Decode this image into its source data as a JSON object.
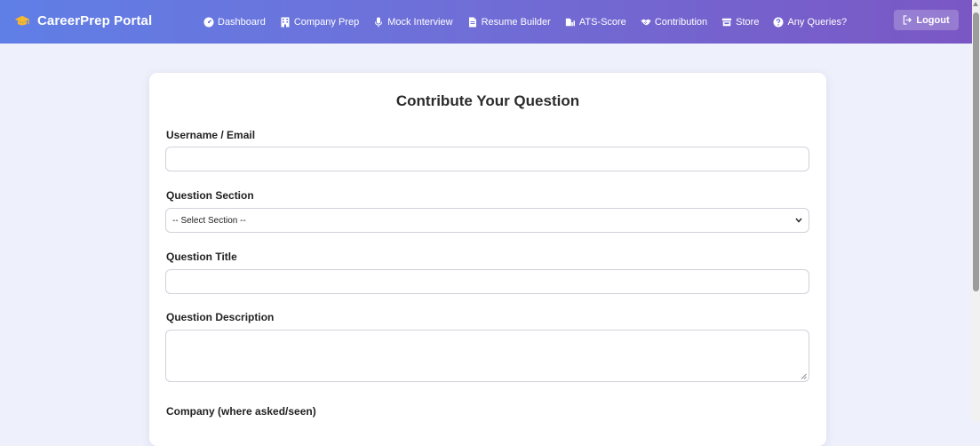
{
  "brand": {
    "title": "CareerPrep Portal",
    "icon": "graduation-cap-icon"
  },
  "nav": {
    "items": [
      {
        "label": "Dashboard",
        "icon": "dashboard-icon"
      },
      {
        "label": "Company Prep",
        "icon": "building-icon"
      },
      {
        "label": "Mock Interview",
        "icon": "microphone-icon"
      },
      {
        "label": "Resume Builder",
        "icon": "document-icon"
      },
      {
        "label": "ATS-Score",
        "icon": "chart-icon"
      },
      {
        "label": "Contribution",
        "icon": "handshake-icon"
      },
      {
        "label": "Store",
        "icon": "store-icon"
      },
      {
        "label": "Any Queries?",
        "icon": "question-circle-icon"
      }
    ],
    "logout_label": "Logout"
  },
  "form": {
    "title": "Contribute Your Question",
    "username_label": "Username / Email",
    "username_value": "",
    "section_label": "Question Section",
    "section_selected": "-- Select Section --",
    "question_title_label": "Question Title",
    "question_title_value": "",
    "description_label": "Question Description",
    "description_value": "",
    "company_label": "Company (where asked/seen)"
  },
  "colors": {
    "nav_gradient_start": "#5f7fe6",
    "nav_gradient_end": "#7a57c4",
    "brand_icon": "#f5b82e",
    "page_background": "#eef0fb"
  }
}
